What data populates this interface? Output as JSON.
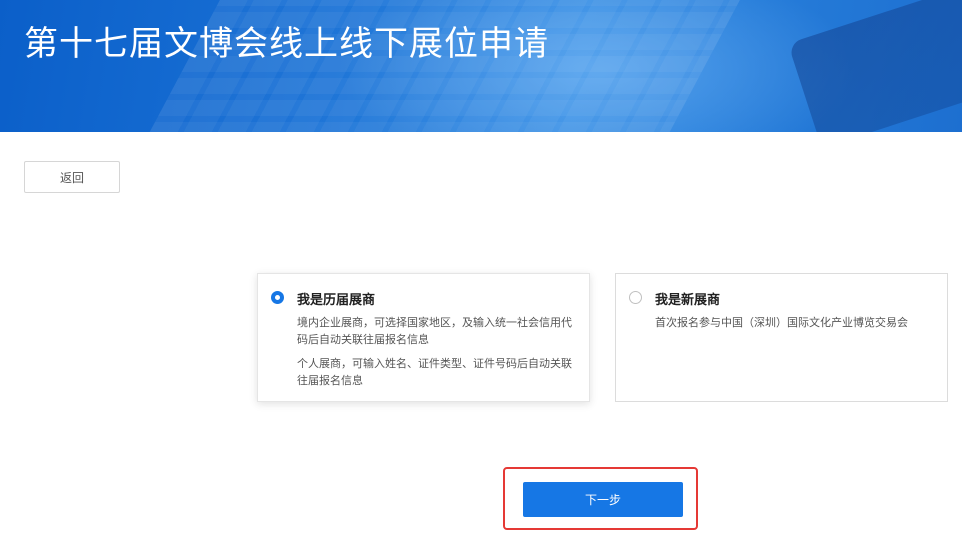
{
  "banner": {
    "title": "第十七届文博会线上线下展位申请"
  },
  "back_button": {
    "label": "返回"
  },
  "options": [
    {
      "title": "我是历届展商",
      "selected": true,
      "descriptions": [
        "境内企业展商，可选择国家地区，及输入统一社会信用代码后自动关联往届报名信息",
        "个人展商，可输入姓名、证件类型、证件号码后自动关联往届报名信息"
      ]
    },
    {
      "title": "我是新展商",
      "selected": false,
      "descriptions": [
        "首次报名参与中国（深圳）国际文化产业博览交易会"
      ]
    }
  ],
  "next_button": {
    "label": "下一步"
  },
  "colors": {
    "primary": "#1677e5",
    "highlight": "#e53935",
    "banner": "#1a72d6"
  }
}
